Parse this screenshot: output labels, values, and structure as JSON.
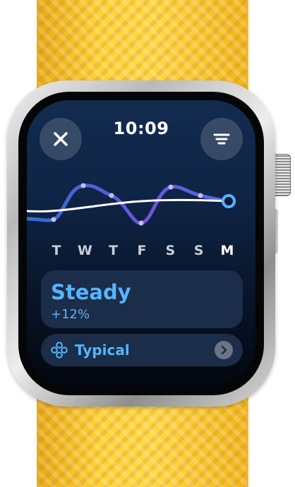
{
  "header": {
    "time": "10:09"
  },
  "icons": {
    "close": "close-icon",
    "menu": "menu-icon",
    "typical": "circles-icon",
    "chevron": "chevron-right-icon"
  },
  "trend": {
    "days": [
      "T",
      "W",
      "T",
      "F",
      "S",
      "S",
      "M"
    ],
    "current_day_index": 6
  },
  "summary": {
    "title": "Steady",
    "change": "+12%"
  },
  "typical": {
    "label": "Typical"
  },
  "colors": {
    "accent": "#56b4ff",
    "band": "#ffd23a",
    "screen_bg": "#0f2445",
    "card_bg": "#1b2d48"
  }
}
